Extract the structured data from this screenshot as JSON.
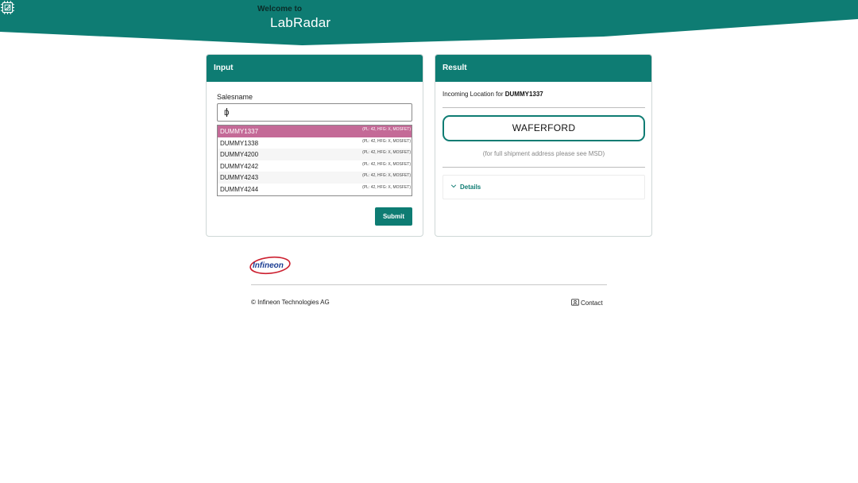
{
  "header": {
    "welcome": "Welcome to",
    "title": "LabRadar",
    "logo_icon": "chip-icon",
    "band_color": "#0e7c73"
  },
  "input_card": {
    "title": "Input",
    "salesname_label": "Salesname",
    "salesname_value": "D",
    "suggestions": [
      {
        "name": "DUMMY1337",
        "meta": "(PL: 42, HFG: X, MOSFET)",
        "selected": true
      },
      {
        "name": "DUMMY1338",
        "meta": "(PL: 42, HFG: X, MOSFET)",
        "selected": false
      },
      {
        "name": "DUMMY4200",
        "meta": "(PL: 42, HFG: X, MOSFET)",
        "selected": false
      },
      {
        "name": "DUMMY4242",
        "meta": "(PL: 42, HFG: X, MOSFET)",
        "selected": false
      },
      {
        "name": "DUMMY4243",
        "meta": "(PL: 42, HFG: X, MOSFET)",
        "selected": false
      },
      {
        "name": "DUMMY4244",
        "meta": "(PL: 42, HFG: X, MOSFET)",
        "selected": false
      }
    ],
    "submit_label": "Submit"
  },
  "result_card": {
    "title": "Result",
    "incoming_prefix": "Incoming Location for",
    "incoming_product": "DUMMY1337",
    "location": "WAFERFORD",
    "hint": "(for full shipment address please see MSD)",
    "details_label": "Details",
    "details_icon": "chevron-down-icon"
  },
  "footer": {
    "brand": "Infineon",
    "copyright": "© Infineon Technologies AG",
    "contact_label": "Contact",
    "contact_icon": "contact-card-icon"
  },
  "colors": {
    "accent": "#0e7c73",
    "selected_suggestion": "#c46a97",
    "brand_blue": "#1c3f94",
    "brand_red": "#cc1f2f"
  }
}
